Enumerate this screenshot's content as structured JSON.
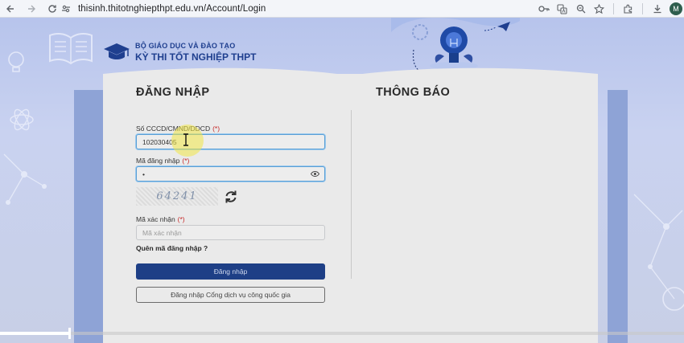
{
  "browser": {
    "url": "thisinh.thitotnghiepthpt.edu.vn/Account/Login",
    "profile_initial": "M",
    "icons": [
      "back-icon",
      "forward-icon",
      "reload-icon",
      "site-info-icon",
      "password-key-icon",
      "translate-icon",
      "zoom-icon",
      "bookmark-star-icon",
      "extensions-icon",
      "download-icon",
      "profile-avatar"
    ]
  },
  "header": {
    "ministry": "BỘ GIÁO DỤC VÀ ĐÀO TẠO",
    "exam_name": "KỲ THI TỐT NGHIỆP THPT"
  },
  "login": {
    "title": "ĐĂNG NHẬP",
    "id_label": "Số CCCD/CMND/DDCD",
    "id_value": "102030405",
    "password_label": "Mã đăng nhập",
    "password_value": "•",
    "captcha_text": "64241",
    "captcha_label": "Mã xác nhận",
    "captcha_placeholder": "Mã xác nhận",
    "required_mark": "(*)",
    "forgot_link": "Quên mã đăng nhập ?",
    "login_button": "Đăng nhập",
    "national_portal_button": "Đăng nhập Cổng dịch vụ công quốc gia"
  },
  "notice": {
    "title": "THÔNG BÁO"
  },
  "video": {
    "progress": 0.1
  },
  "colors": {
    "brand_blue": "#1f3f8f",
    "primary_button": "#1e3f86",
    "required_red": "#c62828",
    "focus_border": "#5a9fd6",
    "cursor_highlight": "#f0e646"
  }
}
